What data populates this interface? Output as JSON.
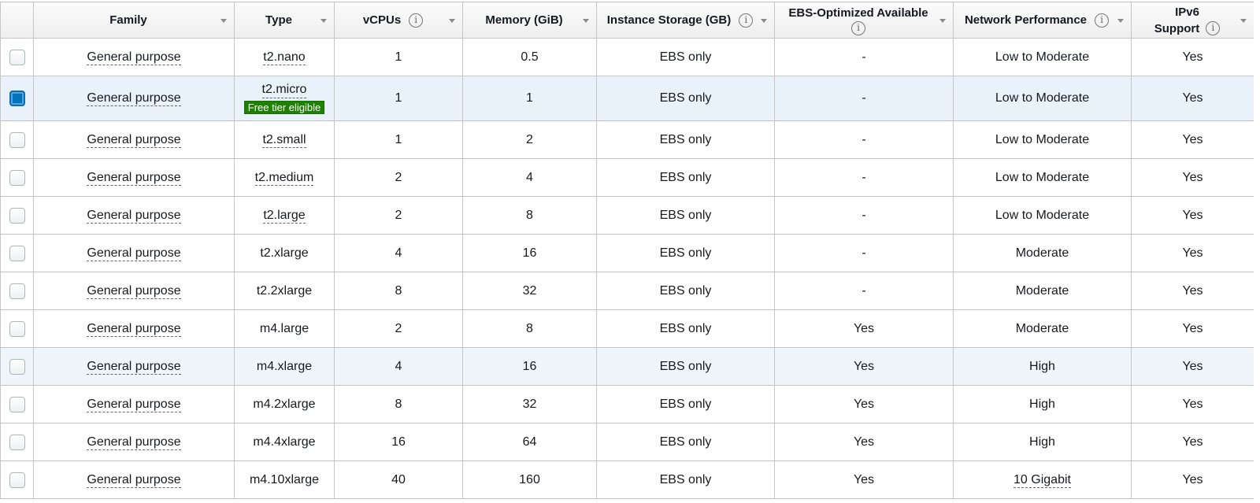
{
  "columns": [
    {
      "key": "select",
      "label": ""
    },
    {
      "key": "family",
      "label": "Family"
    },
    {
      "key": "type",
      "label": "Type"
    },
    {
      "key": "vcpus",
      "label": "vCPUs"
    },
    {
      "key": "memory",
      "label": "Memory (GiB)"
    },
    {
      "key": "storage",
      "label": "Instance Storage (GB)"
    },
    {
      "key": "ebs",
      "label_line1": "EBS-Optimized Available"
    },
    {
      "key": "network",
      "label": "Network Performance"
    },
    {
      "key": "ipv6",
      "label_line1": "IPv6",
      "label_line2": "Support"
    }
  ],
  "info_icon_glyph": "i",
  "badge_text": "Free tier eligible",
  "rows": [
    {
      "family": "General purpose",
      "type": "t2.nano",
      "vcpus": "1",
      "memory": "0.5",
      "storage": "EBS only",
      "ebs": "-",
      "network": "Low to Moderate",
      "ipv6": "Yes",
      "selected": false
    },
    {
      "family": "General purpose",
      "type": "t2.micro",
      "free_tier": true,
      "vcpus": "1",
      "memory": "1",
      "storage": "EBS only",
      "ebs": "-",
      "network": "Low to Moderate",
      "ipv6": "Yes",
      "selected": true
    },
    {
      "family": "General purpose",
      "type": "t2.small",
      "vcpus": "1",
      "memory": "2",
      "storage": "EBS only",
      "ebs": "-",
      "network": "Low to Moderate",
      "ipv6": "Yes",
      "selected": false
    },
    {
      "family": "General purpose",
      "type": "t2.medium",
      "vcpus": "2",
      "memory": "4",
      "storage": "EBS only",
      "ebs": "-",
      "network": "Low to Moderate",
      "ipv6": "Yes",
      "selected": false
    },
    {
      "family": "General purpose",
      "type": "t2.large",
      "vcpus": "2",
      "memory": "8",
      "storage": "EBS only",
      "ebs": "-",
      "network": "Low to Moderate",
      "ipv6": "Yes",
      "selected": false
    },
    {
      "family": "General purpose",
      "type": "t2.xlarge",
      "vcpus": "4",
      "memory": "16",
      "storage": "EBS only",
      "ebs": "-",
      "network": "Moderate",
      "ipv6": "Yes",
      "selected": false
    },
    {
      "family": "General purpose",
      "type": "t2.2xlarge",
      "vcpus": "8",
      "memory": "32",
      "storage": "EBS only",
      "ebs": "-",
      "network": "Moderate",
      "ipv6": "Yes",
      "selected": false
    },
    {
      "family": "General purpose",
      "type": "m4.large",
      "vcpus": "2",
      "memory": "8",
      "storage": "EBS only",
      "ebs": "Yes",
      "network": "Moderate",
      "ipv6": "Yes",
      "selected": false
    },
    {
      "family": "General purpose",
      "type": "m4.xlarge",
      "vcpus": "4",
      "memory": "16",
      "storage": "EBS only",
      "ebs": "Yes",
      "network": "High",
      "ipv6": "Yes",
      "selected": false,
      "hover": true
    },
    {
      "family": "General purpose",
      "type": "m4.2xlarge",
      "vcpus": "8",
      "memory": "32",
      "storage": "EBS only",
      "ebs": "Yes",
      "network": "High",
      "ipv6": "Yes",
      "selected": false
    },
    {
      "family": "General purpose",
      "type": "m4.4xlarge",
      "vcpus": "16",
      "memory": "64",
      "storage": "EBS only",
      "ebs": "Yes",
      "network": "High",
      "ipv6": "Yes",
      "selected": false
    },
    {
      "family": "General purpose",
      "type": "m4.10xlarge",
      "vcpus": "40",
      "memory": "160",
      "storage": "EBS only",
      "ebs": "Yes",
      "network": "10 Gigabit",
      "ipv6": "Yes",
      "selected": false
    }
  ]
}
